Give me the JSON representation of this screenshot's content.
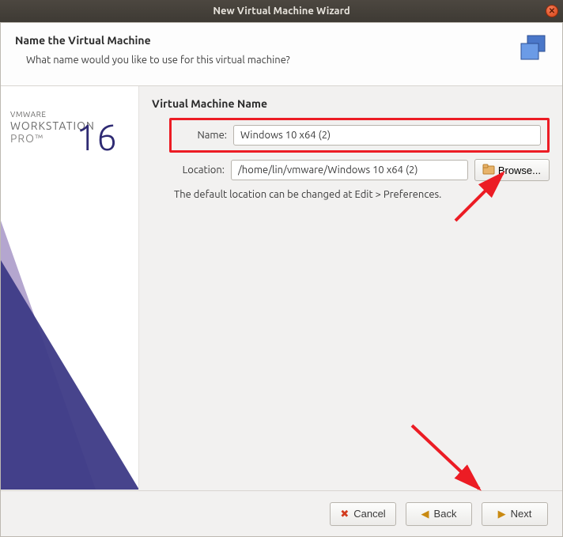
{
  "titlebar": {
    "title": "New Virtual Machine Wizard"
  },
  "header": {
    "title": "Name the Virtual Machine",
    "subtitle": "What name would you like to use for this virtual machine?"
  },
  "sidebar": {
    "brand_small": "VMWARE",
    "brand_main": "WORKSTATION",
    "brand_pro": "PRO™",
    "version": "16"
  },
  "form": {
    "section_title": "Virtual Machine Name",
    "name_label": "Name:",
    "name_value": "Windows 10 x64 (2)",
    "location_label": "Location:",
    "location_value": "/home/lin/vmware/Windows 10 x64 (2)",
    "browse_label": "Browse...",
    "hint": "The default location can be changed at Edit > Preferences."
  },
  "footer": {
    "cancel": "Cancel",
    "back": "Back",
    "next": "Next"
  },
  "colors": {
    "annotation": "#ec1c24",
    "accent": "#2e2a73"
  }
}
